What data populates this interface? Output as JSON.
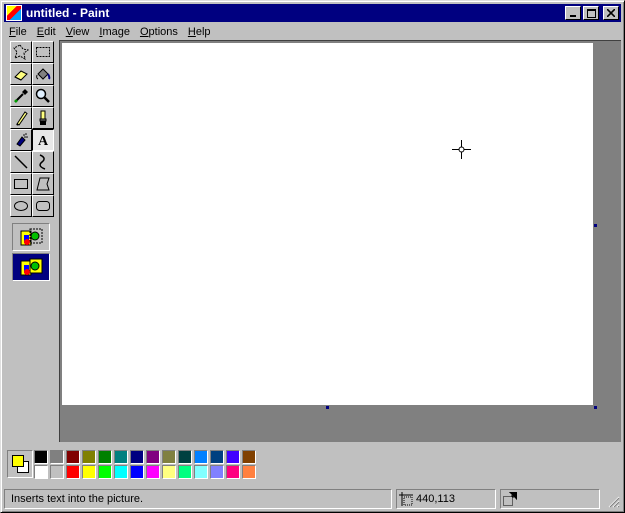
{
  "window": {
    "title": "untitled - Paint"
  },
  "menu": [
    {
      "label": "File"
    },
    {
      "label": "Edit"
    },
    {
      "label": "View"
    },
    {
      "label": "Image"
    },
    {
      "label": "Options"
    },
    {
      "label": "Help"
    }
  ],
  "tools": [
    {
      "name": "free-form-select-tool",
      "icon": "free-form-select-icon"
    },
    {
      "name": "select-tool",
      "icon": "rect-select-icon"
    },
    {
      "name": "eraser-tool",
      "icon": "eraser-icon"
    },
    {
      "name": "fill-tool",
      "icon": "fill-bucket-icon"
    },
    {
      "name": "pick-color-tool",
      "icon": "eyedropper-icon"
    },
    {
      "name": "magnifier-tool",
      "icon": "magnifier-icon"
    },
    {
      "name": "pencil-tool",
      "icon": "pencil-icon"
    },
    {
      "name": "brush-tool",
      "icon": "brush-icon"
    },
    {
      "name": "airbrush-tool",
      "icon": "airbrush-icon"
    },
    {
      "name": "text-tool",
      "icon": "text-icon",
      "selected": true
    },
    {
      "name": "line-tool",
      "icon": "line-icon"
    },
    {
      "name": "curve-tool",
      "icon": "curve-icon"
    },
    {
      "name": "rectangle-tool",
      "icon": "rectangle-icon"
    },
    {
      "name": "polygon-tool",
      "icon": "polygon-icon"
    },
    {
      "name": "ellipse-tool",
      "icon": "ellipse-icon"
    },
    {
      "name": "rounded-rectangle-tool",
      "icon": "rounded-rectangle-icon"
    }
  ],
  "text_options": {
    "selected": "opaque"
  },
  "colors": {
    "foreground": "#ffff00",
    "background": "#ffffff",
    "accent": "#000080",
    "palette_row1": [
      "#000000",
      "#808080",
      "#800000",
      "#808000",
      "#008000",
      "#008080",
      "#000080",
      "#800080",
      "#808040",
      "#004040",
      "#0080ff",
      "#004080",
      "#4000ff",
      "#804000"
    ],
    "palette_row2": [
      "#ffffff",
      "#c0c0c0",
      "#ff0000",
      "#ffff00",
      "#00ff00",
      "#00ffff",
      "#0000ff",
      "#ff00ff",
      "#ffff80",
      "#00ff80",
      "#80ffff",
      "#8080ff",
      "#ff0080",
      "#ff8040"
    ]
  },
  "status": {
    "message": "Inserts text into the picture.",
    "coordinates": "440,113",
    "size": ""
  }
}
